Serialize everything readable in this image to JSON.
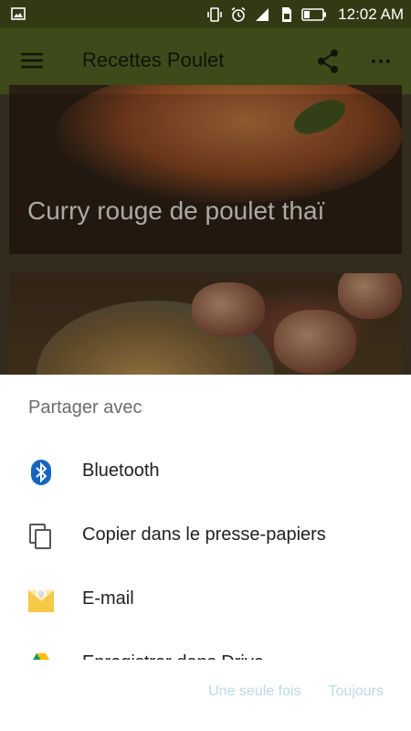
{
  "status_bar": {
    "time": "12:02 AM"
  },
  "app_bar": {
    "title": "Recettes Poulet",
    "menu_icon": "hamburger-menu-icon",
    "share_icon": "share-icon",
    "more_icon": "more-horizontal-icon"
  },
  "content": {
    "cards": [
      {
        "caption": "Curry rouge de poulet thaï"
      },
      {
        "caption": ""
      }
    ]
  },
  "share_sheet": {
    "title": "Partager avec",
    "items": [
      {
        "label": "Bluetooth",
        "icon": "bluetooth-icon"
      },
      {
        "label": "Copier dans le presse-papiers",
        "icon": "copy-icon"
      },
      {
        "label": "E-mail",
        "icon": "email-icon"
      },
      {
        "label": "Enregistrer dans Drive",
        "icon": "drive-icon"
      }
    ],
    "actions": {
      "just_once": "Une seule fois",
      "always": "Toujours"
    }
  },
  "colors": {
    "status_bar": "#323a14",
    "app_bar": "#3e4a1a",
    "action_text": "#bcd8e6"
  }
}
